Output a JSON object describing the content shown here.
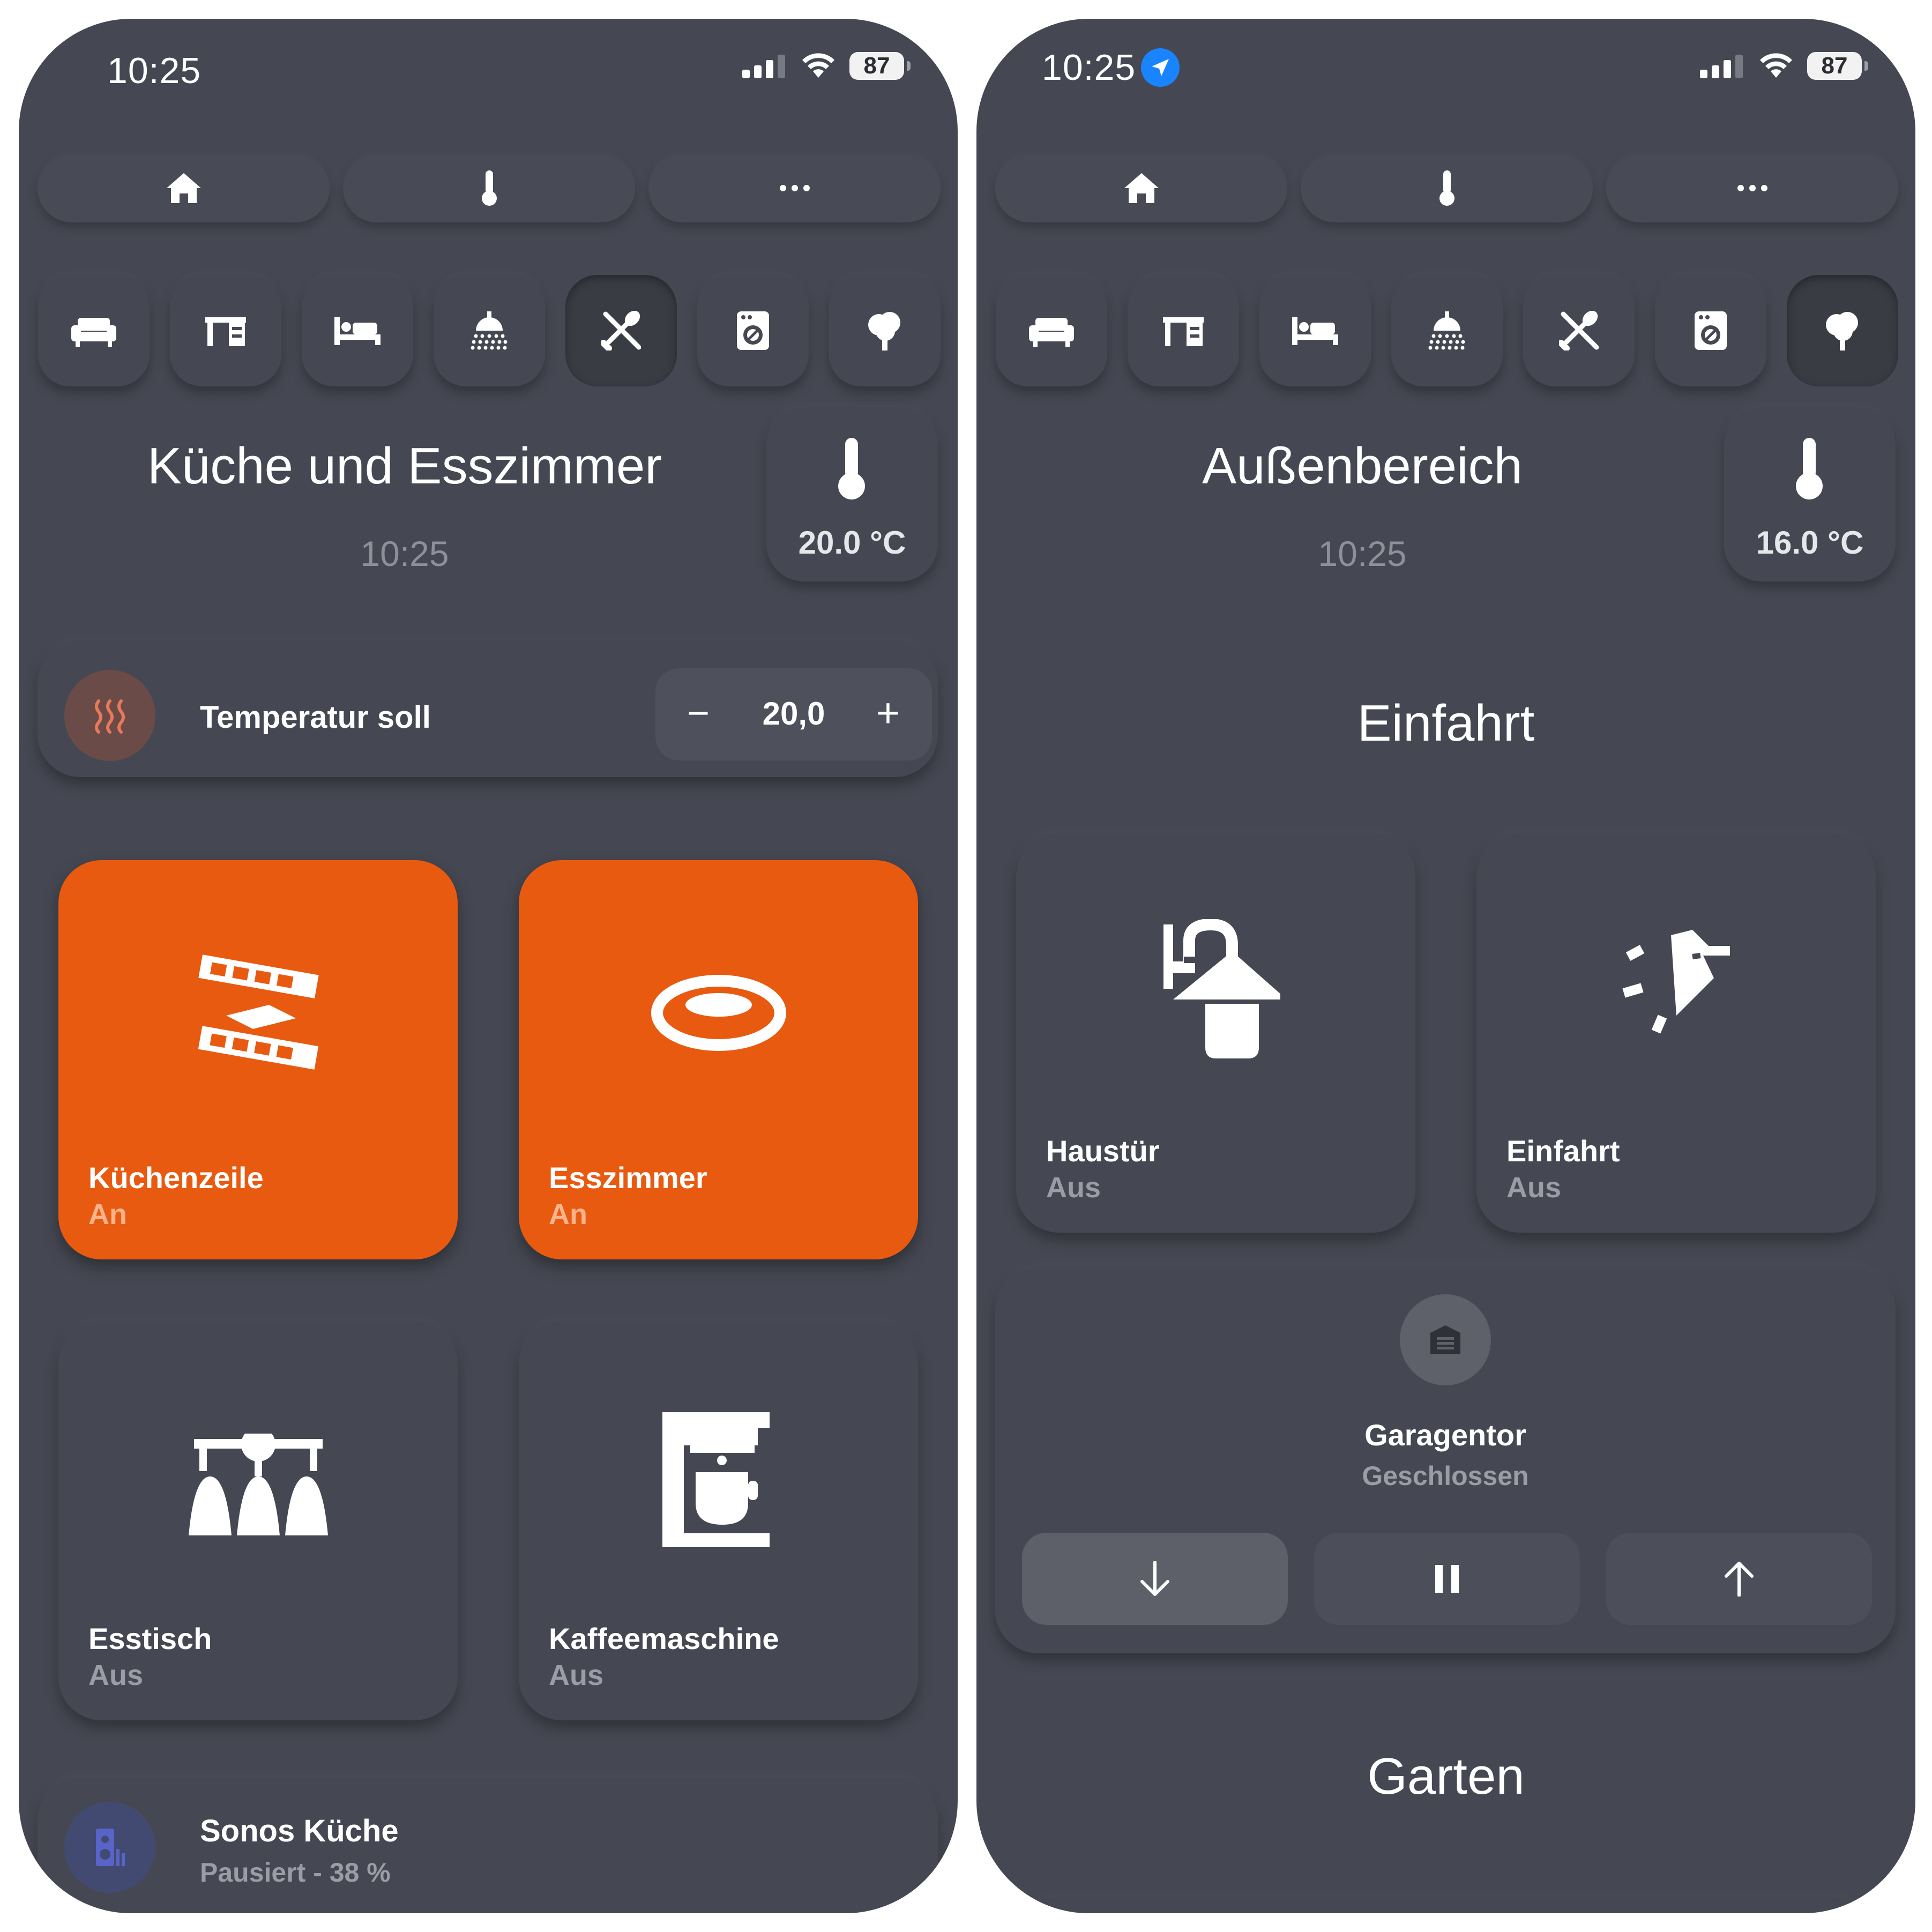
{
  "left": {
    "status": {
      "time": "10:25",
      "battery": "87"
    },
    "tabs": [
      {
        "icon": "home-icon"
      },
      {
        "icon": "thermometer-icon"
      },
      {
        "icon": "more-icon"
      }
    ],
    "room_nav": [
      "sofa-icon",
      "desk-icon",
      "bed-icon",
      "shower-icon",
      "cutlery-icon",
      "washer-icon",
      "tree-icon"
    ],
    "room_nav_active": "cutlery-icon",
    "room": {
      "title": "Küche und Esszimmer",
      "time": "10:25",
      "temperature": "20.0 °C"
    },
    "thermostat": {
      "label": "Temperatur soll",
      "value": "20,0",
      "minus": "−",
      "plus": "+",
      "icon": "heat-icon",
      "accent": "#e8795a"
    },
    "lights": [
      {
        "name": "Küchenzeile",
        "state": "An",
        "on": true,
        "icon": "kitchen-counter-light-icon"
      },
      {
        "name": "Esszimmer",
        "state": "An",
        "on": true,
        "icon": "ceiling-ring-light-icon"
      },
      {
        "name": "Esstisch",
        "state": "Aus",
        "on": false,
        "icon": "pendant-lights-icon"
      },
      {
        "name": "Kaffeemaschine",
        "state": "Aus",
        "on": false,
        "icon": "coffee-machine-icon"
      }
    ],
    "media": {
      "name": "Sonos Küche",
      "state": "Pausiert - 38 %",
      "icon": "speaker-icon"
    },
    "colors": {
      "accent_on": "#e95a11",
      "background": "#454852"
    }
  },
  "right": {
    "status": {
      "time": "10:25",
      "battery": "87",
      "location_icon": "location-arrow-icon"
    },
    "tabs": [
      {
        "icon": "home-icon"
      },
      {
        "icon": "thermometer-icon"
      },
      {
        "icon": "more-icon"
      }
    ],
    "room_nav": [
      "sofa-icon",
      "desk-icon",
      "bed-icon",
      "shower-icon",
      "cutlery-icon",
      "washer-icon",
      "tree-icon"
    ],
    "room": {
      "title": "Außenbereich",
      "time": "10:25",
      "temperature": "16.0 °C"
    },
    "section_einfahrt": "Einfahrt",
    "lights": [
      {
        "name": "Haustür",
        "state": "Aus",
        "icon": "wall-lantern-icon"
      },
      {
        "name": "Einfahrt",
        "state": "Aus",
        "icon": "floodlight-icon"
      }
    ],
    "garage": {
      "name": "Garagentor",
      "state": "Geschlossen",
      "icon": "garage-icon",
      "buttons": [
        "arrow-down-icon",
        "pause-icon",
        "arrow-up-icon"
      ]
    },
    "section_garten": "Garten"
  }
}
